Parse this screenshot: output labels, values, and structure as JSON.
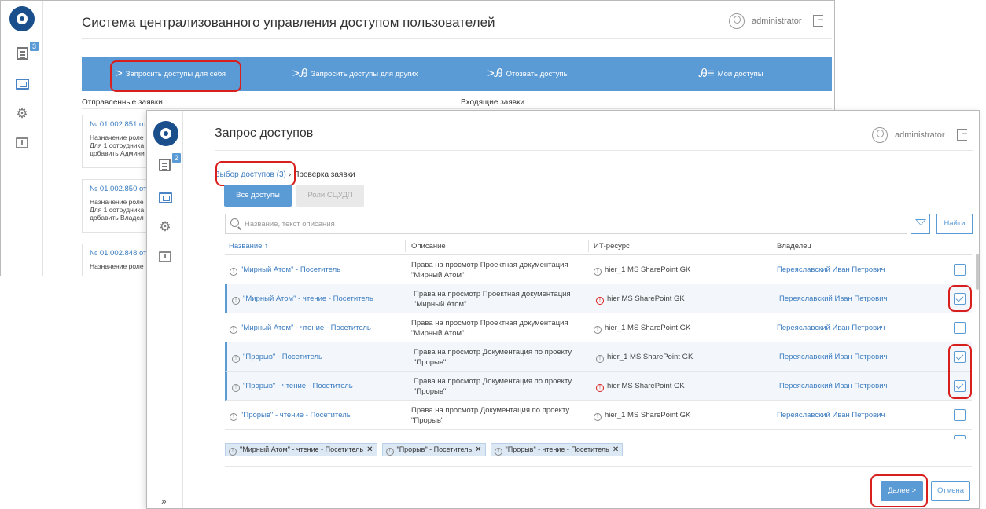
{
  "background_window": {
    "title": "Система централизованного управления доступом пользователей",
    "user": "administrator",
    "sidebar": {
      "badge": "3"
    },
    "nav": [
      {
        "glyph": ">",
        "label": "Запросить доступы для себя"
      },
      {
        "glyph": ">Ꭿ",
        "label": "Запросить доступы для других"
      },
      {
        "glyph": ">Ꭿ",
        "label": "Отозвать доступы"
      },
      {
        "glyph": "Ꭿ≡",
        "label": "Мои доступы"
      }
    ],
    "sent_label": "Отправленные заявки",
    "incoming_label": "Входящие заявки",
    "cards": [
      {
        "number": "№ 01.002.851 от",
        "lines": [
          "Назначение роле",
          "Для 1 сотрудника",
          "добавить Админи"
        ]
      },
      {
        "number": "№ 01.002.850 от",
        "lines": [
          "Назначение роле",
          "Для 1 сотрудника",
          "добавить Владел"
        ]
      },
      {
        "number": "№ 01.002.848 от",
        "lines": [
          "Назначение роле"
        ]
      }
    ]
  },
  "foreground_window": {
    "title": "Запрос доступов",
    "user": "administrator",
    "sidebar": {
      "badge": "2",
      "expand": "»"
    },
    "breadcrumb": {
      "active": "Выбор доступов (3)",
      "separator": "›",
      "next": "Проверка заявки"
    },
    "tabs": [
      {
        "label": "Все доступы",
        "active": true
      },
      {
        "label": "Роли СЦУДП",
        "active": false
      }
    ],
    "search": {
      "placeholder": "Название, текст описания",
      "value": ""
    },
    "find_label": "Найти",
    "columns": {
      "name": "Название",
      "name_sort": "↑",
      "description": "Описание",
      "resource": "ИТ-ресурс",
      "owner": "Владелец"
    },
    "rows": [
      {
        "name": "\"Мирный Атом\" - Посетитель",
        "description": "Права на просмотр Проектная документация \"Мирный Атом\"",
        "resource": "hier_1 MS SharePoint GK",
        "resource_alert": false,
        "owner": "Переяславский Иван Петрович",
        "checked": false
      },
      {
        "name": "\"Мирный Атом\" - чтение - Посетитель",
        "description": "Права на просмотр Проектная документация \"Мирный Атом\"",
        "resource": "hier MS SharePoint GK",
        "resource_alert": true,
        "owner": "Переяславский Иван Петрович",
        "checked": true
      },
      {
        "name": "\"Мирный Атом\" - чтение - Посетитель",
        "description": "Права на просмотр Проектная документация \"Мирный Атом\"",
        "resource": "hier_1 MS SharePoint GK",
        "resource_alert": false,
        "owner": "Переяславский Иван Петрович",
        "checked": false
      },
      {
        "name": "\"Прорыв\" - Посетитель",
        "description": "Права на просмотр Документация по проекту \"Прорыв\"",
        "resource": "hier_1 MS SharePoint GK",
        "resource_alert": false,
        "owner": "Переяславский Иван Петрович",
        "checked": true
      },
      {
        "name": "\"Прорыв\" - чтение - Посетитель",
        "description": "Права на просмотр Документация по проекту \"Прорыв\"",
        "resource": "hier MS SharePoint GK",
        "resource_alert": true,
        "owner": "Переяславский Иван Петрович",
        "checked": true
      },
      {
        "name": "\"Прорыв\" - чтение - Посетитель",
        "description": "Права на просмотр Документация по проекту \"Прорыв\"",
        "resource": "hier_1 MS SharePoint GK",
        "resource_alert": false,
        "owner": "Переяславский Иван Петрович",
        "checked": false
      }
    ],
    "selected_chips": [
      "\"Мирный Атом\" - чтение - Посетитель",
      "\"Прорыв\" - Посетитель",
      "\"Прорыв\" - чтение - Посетитель"
    ],
    "chip_remove": "✕",
    "info_glyph": "!",
    "next_label": "Далее >",
    "cancel_label": "Отмена"
  },
  "colors": {
    "accent": "#5b9bd5",
    "link": "#3a7bbf",
    "highlight": "#d91e1e",
    "logo": "#1a4f8b"
  }
}
